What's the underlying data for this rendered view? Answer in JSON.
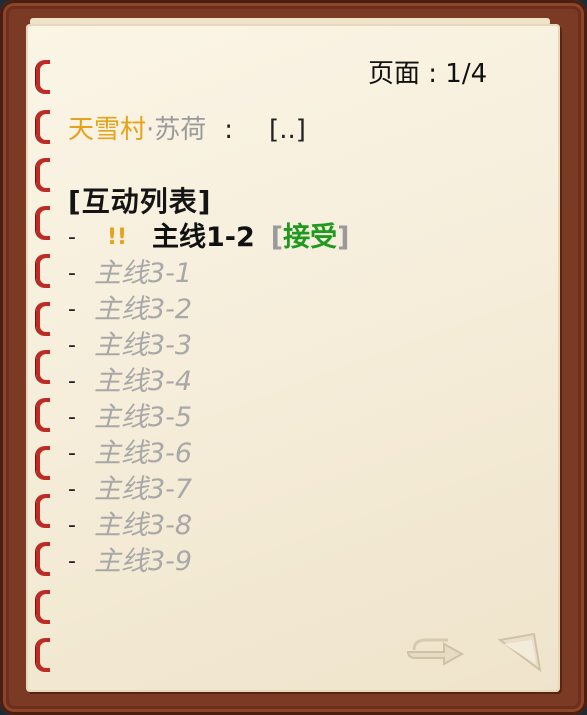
{
  "header": {
    "page_indicator": "页面 : 1/4"
  },
  "speaker": {
    "village": "天雪村",
    "name": "·苏荷",
    "colon": ":",
    "dialog": "[..]"
  },
  "interaction": {
    "title": "[互动列表]",
    "active_item": {
      "dash": "-",
      "marker": "!!",
      "name": "主线1-2",
      "accept_open": "[",
      "accept_label": "接受",
      "accept_close": "]"
    },
    "items": [
      {
        "dash": "-",
        "name": "主线3-1"
      },
      {
        "dash": "-",
        "name": "主线3-2"
      },
      {
        "dash": "-",
        "name": "主线3-3"
      },
      {
        "dash": "-",
        "name": "主线3-4"
      },
      {
        "dash": "-",
        "name": "主线3-5"
      },
      {
        "dash": "-",
        "name": "主线3-6"
      },
      {
        "dash": "-",
        "name": "主线3-7"
      },
      {
        "dash": "-",
        "name": "主线3-8"
      },
      {
        "dash": "-",
        "name": "主线3-9"
      }
    ]
  },
  "colors": {
    "village": "#e6a21a",
    "accept": "#1f9a1f",
    "dim": "#a8a8a8",
    "ring": "#c12a22"
  },
  "icons": {
    "next_page": "arrow-right-icon",
    "page_corner": "page-curl-icon"
  }
}
